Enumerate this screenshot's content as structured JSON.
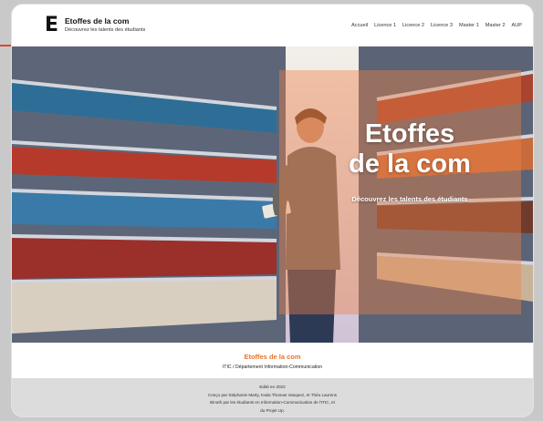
{
  "header": {
    "logo_letter": "E",
    "title": "Etoffes de la com",
    "subtitle": "Découvrez les talents des étudiants"
  },
  "nav": {
    "items": [
      "Accueil",
      "Licence 1",
      "Licence 2",
      "Licence 3",
      "Master 1",
      "Master 2",
      "AUP"
    ]
  },
  "hero": {
    "title_line1": "Etoffes",
    "title_line2": "de la com",
    "subtitle": "Découvrez les talents des étudiants"
  },
  "footer": {
    "brand": "Etoffes de la com",
    "department": "ITIC / Département Information-Communication",
    "edition": "Edité en 2022",
    "credits_line1": "Conçu par Stéphanie Marty, Katia Thomas Vasquez, et Théo Laurens",
    "credits_line2": "Binoth par les étudiants en Information-Communication de l'ITIC, et",
    "credits_line3": "du Projet Up."
  },
  "colors": {
    "accent": "#e8742c",
    "overlay": "#ee8048",
    "redline": "#d9472b"
  }
}
